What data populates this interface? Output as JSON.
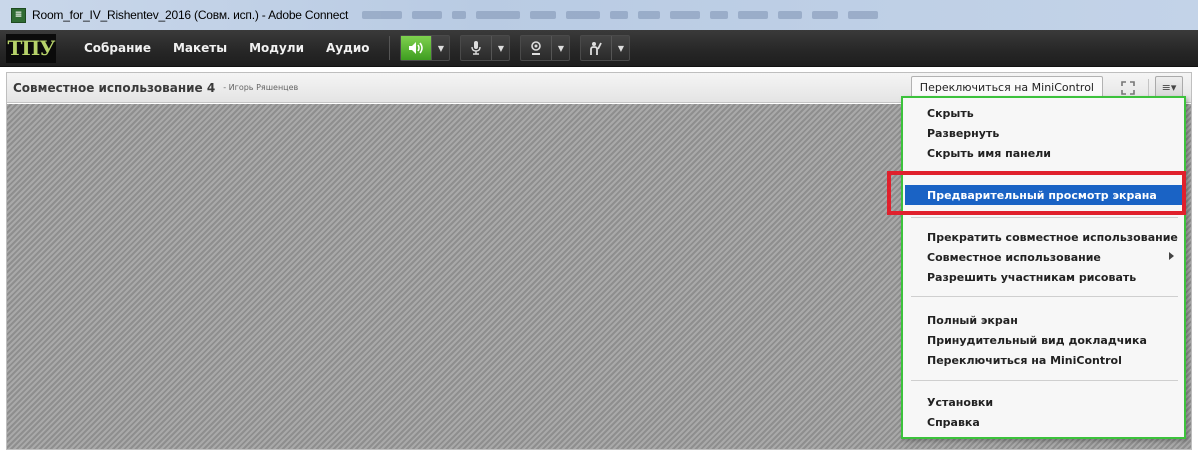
{
  "window": {
    "title": "Room_for_IV_Rishentev_2016 (Совм. исп.) - Adobe Connect",
    "icon": "app-icon"
  },
  "menubar": {
    "logo_text": "ТПУ",
    "items": [
      "Собрание",
      "Макеты",
      "Модули",
      "Аудио"
    ],
    "controls": [
      {
        "name": "speaker-icon",
        "active": true
      },
      {
        "name": "microphone-icon",
        "active": false
      },
      {
        "name": "webcam-icon",
        "active": false
      },
      {
        "name": "raise-hand-icon",
        "active": false
      }
    ],
    "accent_green": "#3e9d20"
  },
  "pod": {
    "title": "Совместное использование 4",
    "subtitle": "- Игорь Ряшенцев",
    "mini_control_label": "Переключиться на MiniControl",
    "expand_icon": "expand-icon",
    "menu_icon": "pod-menu-icon"
  },
  "context_menu": {
    "border_color": "#3cc23c",
    "highlight_color": "#e0202c",
    "groups": [
      [
        "Скрыть",
        "Развернуть",
        "Скрыть имя панели"
      ],
      [
        "Предварительный просмотр экрана"
      ],
      [
        "Прекратить совместное использование",
        "Совместное использование",
        "Разрешить участникам рисовать"
      ],
      [
        "Полный экран",
        "Принудительный вид докладчика",
        "Переключиться на MiniControl"
      ],
      [
        "Установки",
        "Справка"
      ]
    ],
    "selected_label": "Предварительный просмотр экрана",
    "submenu_label": "Совместное использование"
  }
}
